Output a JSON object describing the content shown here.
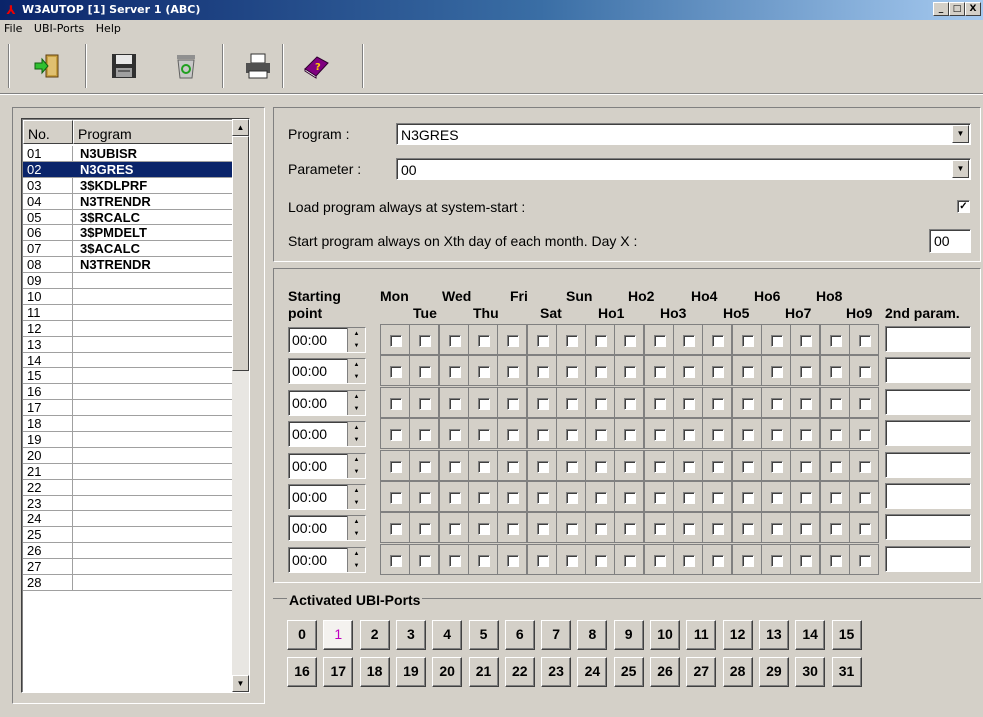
{
  "window": {
    "title": "W3AUTOP [1] Server 1 (ABC)",
    "minimize": "_",
    "restore": "□",
    "close": "X"
  },
  "menu": {
    "items": [
      "File",
      "UBI-Ports",
      "Help"
    ]
  },
  "toolbar": {
    "buttons": [
      "exit-icon",
      "save-icon",
      "recycle-bin-icon",
      "printer-icon",
      "help-book-icon"
    ]
  },
  "list": {
    "col_no": "No.",
    "col_program": "Program",
    "selected_index": 1,
    "rows": [
      {
        "no": "01",
        "program": "N3UBISR"
      },
      {
        "no": "02",
        "program": "N3GRES"
      },
      {
        "no": "03",
        "program": "3$KDLPRF"
      },
      {
        "no": "04",
        "program": "N3TRENDR"
      },
      {
        "no": "05",
        "program": "3$RCALC"
      },
      {
        "no": "06",
        "program": "3$PMDELT"
      },
      {
        "no": "07",
        "program": "3$ACALC"
      },
      {
        "no": "08",
        "program": "N3TRENDR"
      },
      {
        "no": "09",
        "program": ""
      },
      {
        "no": "10",
        "program": ""
      },
      {
        "no": "11",
        "program": ""
      },
      {
        "no": "12",
        "program": ""
      },
      {
        "no": "13",
        "program": ""
      },
      {
        "no": "14",
        "program": ""
      },
      {
        "no": "15",
        "program": ""
      },
      {
        "no": "16",
        "program": ""
      },
      {
        "no": "17",
        "program": ""
      },
      {
        "no": "18",
        "program": ""
      },
      {
        "no": "19",
        "program": ""
      },
      {
        "no": "20",
        "program": ""
      },
      {
        "no": "21",
        "program": ""
      },
      {
        "no": "22",
        "program": ""
      },
      {
        "no": "23",
        "program": ""
      },
      {
        "no": "24",
        "program": ""
      },
      {
        "no": "25",
        "program": ""
      },
      {
        "no": "26",
        "program": ""
      },
      {
        "no": "27",
        "program": ""
      },
      {
        "no": "28",
        "program": ""
      }
    ]
  },
  "settings": {
    "program_label": "Program :",
    "program_value": "N3GRES",
    "parameter_label": "Parameter :",
    "parameter_value": "00",
    "load_label": "Load program always at system-start :",
    "load_checked": true,
    "day_label": "Start program always on Xth day of each month. Day X :",
    "day_value": "00"
  },
  "schedule": {
    "starting_label": "Starting",
    "point_label": "point",
    "days_top": [
      "Mon",
      "Wed",
      "Fri",
      "Sun",
      "Ho2",
      "Ho4",
      "Ho6",
      "Ho8"
    ],
    "days_bottom": [
      "Tue",
      "Thu",
      "Sat",
      "Ho1",
      "Ho3",
      "Ho5",
      "Ho7",
      "Ho9"
    ],
    "second_param_label": "2nd param.",
    "times": [
      "00:00",
      "00:00",
      "00:00",
      "00:00",
      "00:00",
      "00:00",
      "00:00",
      "00:00"
    ]
  },
  "ports": {
    "title": "Activated UBI-Ports",
    "labels": [
      "0",
      "1",
      "2",
      "3",
      "4",
      "5",
      "6",
      "7",
      "8",
      "9",
      "10",
      "11",
      "12",
      "13",
      "14",
      "15",
      "16",
      "17",
      "18",
      "19",
      "20",
      "21",
      "22",
      "23",
      "24",
      "25",
      "26",
      "27",
      "28",
      "29",
      "30",
      "31"
    ],
    "active": [
      "1"
    ]
  }
}
